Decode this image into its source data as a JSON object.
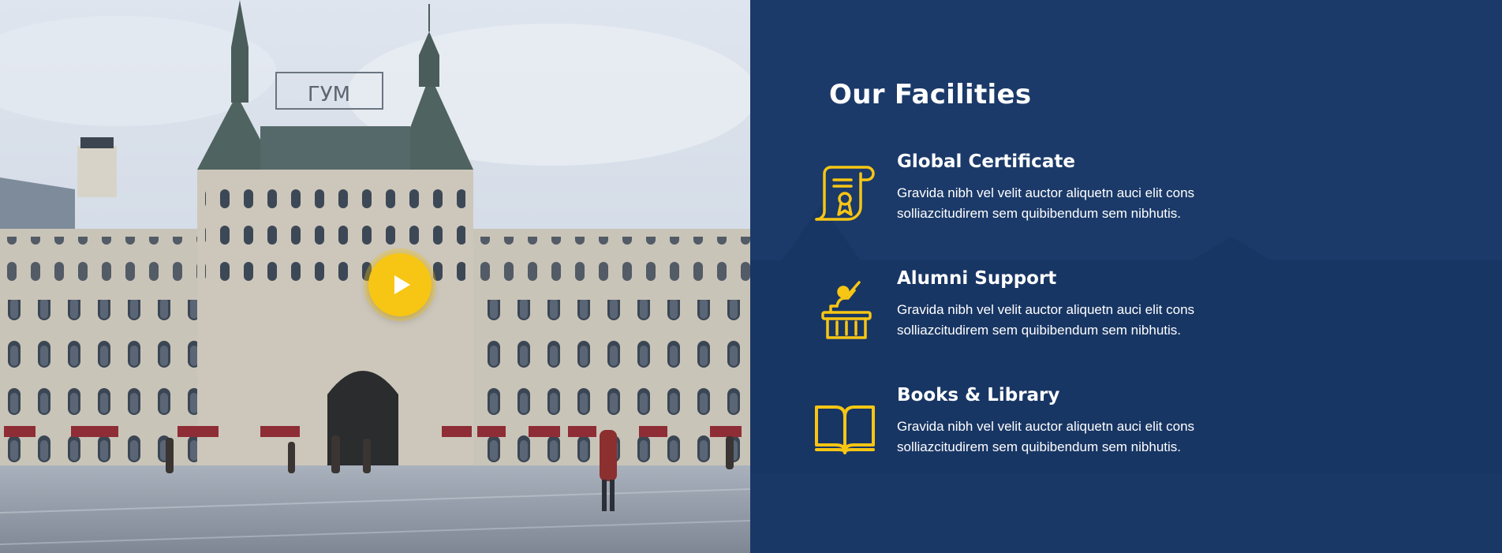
{
  "video": {
    "play_icon": "play-icon",
    "accent": "#f7c614"
  },
  "building_sign": "ГУМ",
  "facilities": {
    "title": "Our Facilities",
    "background": "#1b3a69",
    "icon_color": "#f7c614",
    "items": [
      {
        "icon": "certificate-icon",
        "title": "Global Certificate",
        "description": "Gravida nibh vel velit auctor aliquetn auci elit cons solliazcitudirem sem quibibendum sem nibhutis."
      },
      {
        "icon": "student-desk-icon",
        "title": "Alumni Support",
        "description": "Gravida nibh vel velit auctor aliquetn auci elit cons solliazcitudirem sem quibibendum sem nibhutis."
      },
      {
        "icon": "open-book-icon",
        "title": "Books & Library",
        "description": "Gravida nibh vel velit auctor aliquetn auci elit cons solliazcitudirem sem quibibendum sem nibhutis."
      }
    ]
  }
}
